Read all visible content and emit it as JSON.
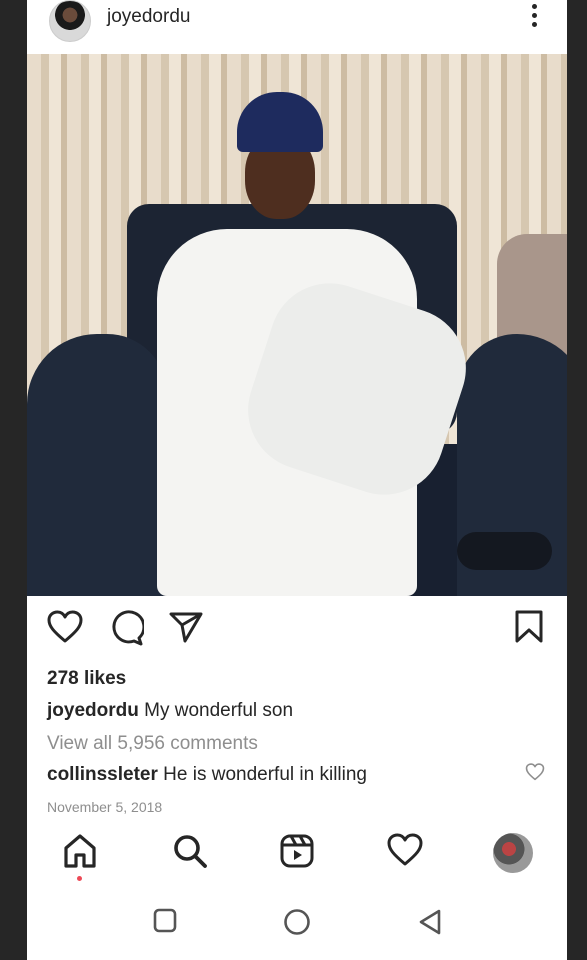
{
  "post": {
    "username": "joyedordu",
    "likes": "278 likes",
    "caption_user": "joyedordu",
    "caption_text": "My wonderful son",
    "view_comments": "View all 5,956 comments",
    "comment_user": "collinssleter",
    "comment_text": "He is wonderful in killing",
    "date": "November 5, 2018"
  },
  "actions": {
    "icons": [
      "heart-icon",
      "comment-icon",
      "share-icon",
      "bookmark-icon"
    ]
  },
  "bottom_nav": {
    "items": [
      "home-icon",
      "search-icon",
      "reels-icon",
      "activity-heart-icon",
      "profile-avatar"
    ]
  },
  "system_nav": {
    "items": [
      "recents-button",
      "home-button",
      "back-button"
    ]
  },
  "colors": {
    "text": "#262626",
    "muted": "#8e8e8e",
    "notification_dot": "#ed4956"
  }
}
